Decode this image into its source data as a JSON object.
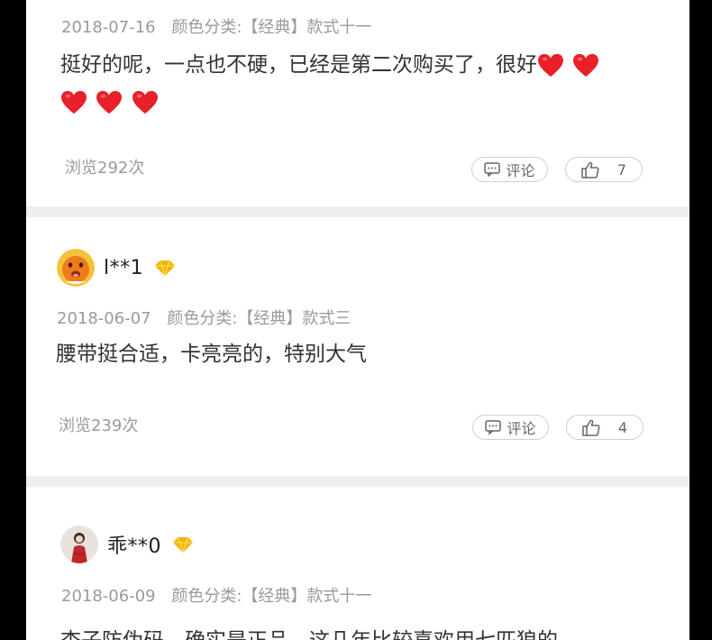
{
  "reviews": [
    {
      "date": "2018-07-16",
      "variant": "颜色分类:【经典】款式十一",
      "text": "挺好的呢，一点也不硬，已经是第二次购买了，很好",
      "views": "浏览292次",
      "comment_label": "评论",
      "likes": "7"
    },
    {
      "username": "l**1",
      "date": "2018-06-07",
      "variant": "颜色分类:【经典】款式三",
      "text": "腰带挺合适，卡亮亮的，特别大气",
      "views": "浏览239次",
      "comment_label": "评论",
      "likes": "4"
    },
    {
      "username": "乖**0",
      "date": "2018-06-09",
      "variant": "颜色分类:【经典】款式十一",
      "text": "杏子防伪码，确实是正品，这几年比较喜欢用七匹狼的"
    }
  ],
  "colors": {
    "heart": "#e8202a",
    "vip_gold": "#f5b400",
    "divider": "#efefef"
  }
}
